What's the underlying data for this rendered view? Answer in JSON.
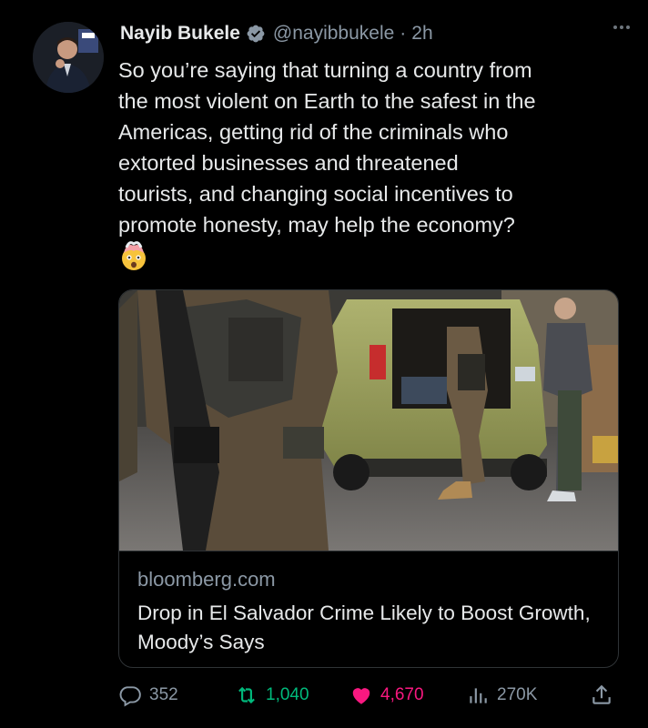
{
  "author": {
    "name": "Nayib Bukele",
    "handle": "@nayibbukele",
    "separator": "·",
    "time": "2h",
    "verified_icon": "verified-badge-icon"
  },
  "tweet": {
    "text": "So you’re saying that turning a country from\nthe most violent on Earth to the safest in the\nAmericas, getting rid of the criminals who\nextorted businesses and threatened\ntourists, and changing social incentives to\npromote honesty, may help the economy?",
    "emoji": "🤯"
  },
  "card": {
    "domain": "bloomberg.com",
    "title": "Drop in El Salvador Crime Likely to Boost Growth, Moody’s Says"
  },
  "actions": {
    "replies": "352",
    "reposts": "1,040",
    "likes": "4,670",
    "views": "270K"
  },
  "colors": {
    "background": "#000000",
    "text": "#e7e9ea",
    "muted": "#8b98a5",
    "verified": "#8b98a5",
    "repost": "#00ba7c",
    "like": "#f91880",
    "border": "#2f3336"
  }
}
